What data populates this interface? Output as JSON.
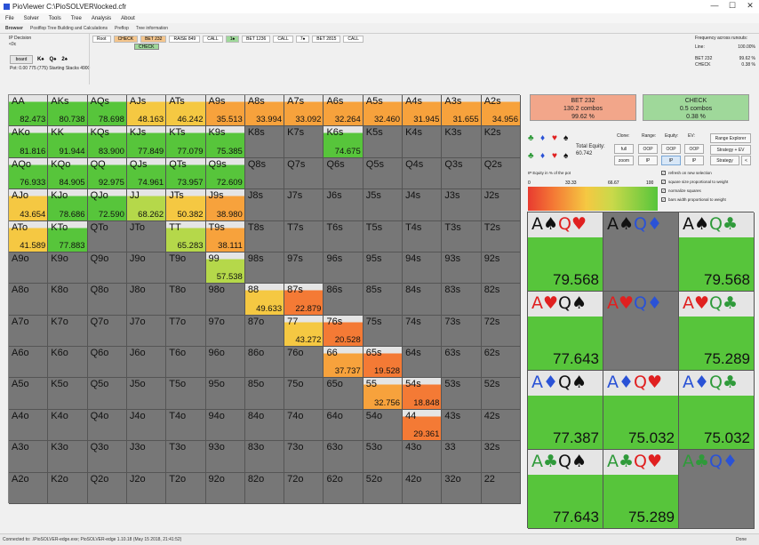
{
  "window": {
    "title": "PioViewer C:\\PioSOLVER\\locked.cfr",
    "minimize": "—",
    "maximize": "☐",
    "close": "✕"
  },
  "menu": [
    "File",
    "Solver",
    "Tools",
    "Tree",
    "Analysis",
    "About"
  ],
  "tabs": [
    "Browser",
    "Postflop Tree Building and Calculations",
    "Preflop",
    "Tree information"
  ],
  "left_info": {
    "decision": "IP Decision",
    "line": "<0c",
    "board_button": "board",
    "board_cards": [
      "K♠",
      "Q♠",
      "2♠"
    ],
    "pot": "Pot: 0.00 775 (775) Starting Stacks 4900"
  },
  "tree_nodes": [
    "Root",
    "CHECK",
    "BET 232",
    "RAISE 849",
    "CALL",
    "1♠",
    "BET 1236",
    "CALL",
    "7♠",
    "BET 2815",
    "CALL"
  ],
  "sub_check": "CHECK",
  "frequency": {
    "title": "Frequency across runouts:",
    "line_label": "Line:",
    "line_value": "100.00%",
    "rows": [
      {
        "label": "BET 232",
        "value": "99.62 %"
      },
      {
        "label": "CHECK",
        "value": "0.38 %"
      }
    ]
  },
  "actions": [
    {
      "name": "BET 232",
      "combos": "130.2 combos",
      "pct": "99.62 %",
      "color": "#f2a68a"
    },
    {
      "name": "CHECK",
      "combos": "0.5 combos",
      "pct": "0.38 %",
      "color": "#9fd89a"
    }
  ],
  "controls": {
    "total_equity_label": "Total Equity:",
    "total_equity_value": "60.742",
    "col_labels": [
      "Clone:",
      "Range:",
      "Equity:",
      "EV:"
    ],
    "buttons_row1": [
      "full",
      "OOP",
      "OOP",
      "OOP"
    ],
    "buttons_row2": [
      "zoom",
      "IP",
      "IP",
      "IP"
    ],
    "range_explorer": "Range Explorer",
    "strategy_ev": "Strategy + EV",
    "strategy": "Strategy",
    "back": "<",
    "ip_equity_note": "IP Equity in % of the pot",
    "checkboxes": [
      "refresh on new selection",
      "square size proportional to weight",
      "normalize squares",
      "bars width proportional to weight"
    ],
    "suits": [
      "♣",
      "♦",
      "♥",
      "♠",
      "♣",
      "♦",
      "♥",
      "♠"
    ]
  },
  "gradient_ticks": [
    "0",
    "33.33",
    "66.67",
    "100"
  ],
  "colors": {
    "empty": "#777777",
    "high": "#57c53b",
    "mid": "#f5c842",
    "low": "#f47a35",
    "red_suit": "#e02020",
    "blue_suit": "#2a52d6",
    "green_suit": "#2f9a3a",
    "black_suit": "#111111"
  },
  "hand_grid": [
    [
      {
        "n": "AA",
        "v": "82.473"
      },
      {
        "n": "AKs",
        "v": "80.738"
      },
      {
        "n": "AQs",
        "v": "78.698"
      },
      {
        "n": "AJs",
        "v": "48.163"
      },
      {
        "n": "ATs",
        "v": "46.242"
      },
      {
        "n": "A9s",
        "v": "35.513"
      },
      {
        "n": "A8s",
        "v": "33.994"
      },
      {
        "n": "A7s",
        "v": "33.092"
      },
      {
        "n": "A6s",
        "v": "32.264"
      },
      {
        "n": "A5s",
        "v": "32.460"
      },
      {
        "n": "A4s",
        "v": "31.945"
      },
      {
        "n": "A3s",
        "v": "31.655"
      },
      {
        "n": "A2s",
        "v": "34.956"
      }
    ],
    [
      {
        "n": "AKo",
        "v": "81.816"
      },
      {
        "n": "KK",
        "v": "91.944"
      },
      {
        "n": "KQs",
        "v": "83.900"
      },
      {
        "n": "KJs",
        "v": "77.849"
      },
      {
        "n": "KTs",
        "v": "77.079"
      },
      {
        "n": "K9s",
        "v": "75.385"
      },
      {
        "n": "K8s",
        "v": ""
      },
      {
        "n": "K7s",
        "v": ""
      },
      {
        "n": "K6s",
        "v": "74.675"
      },
      {
        "n": "K5s",
        "v": ""
      },
      {
        "n": "K4s",
        "v": ""
      },
      {
        "n": "K3s",
        "v": ""
      },
      {
        "n": "K2s",
        "v": ""
      }
    ],
    [
      {
        "n": "AQo",
        "v": "76.933"
      },
      {
        "n": "KQo",
        "v": "84.905"
      },
      {
        "n": "QQ",
        "v": "92.975"
      },
      {
        "n": "QJs",
        "v": "74.961"
      },
      {
        "n": "QTs",
        "v": "73.957"
      },
      {
        "n": "Q9s",
        "v": "72.609"
      },
      {
        "n": "Q8s",
        "v": ""
      },
      {
        "n": "Q7s",
        "v": ""
      },
      {
        "n": "Q6s",
        "v": ""
      },
      {
        "n": "Q5s",
        "v": ""
      },
      {
        "n": "Q4s",
        "v": ""
      },
      {
        "n": "Q3s",
        "v": ""
      },
      {
        "n": "Q2s",
        "v": ""
      }
    ],
    [
      {
        "n": "AJo",
        "v": "43.654"
      },
      {
        "n": "KJo",
        "v": "78.686"
      },
      {
        "n": "QJo",
        "v": "72.590"
      },
      {
        "n": "JJ",
        "v": "68.262"
      },
      {
        "n": "JTs",
        "v": "50.382"
      },
      {
        "n": "J9s",
        "v": "38.980"
      },
      {
        "n": "J8s",
        "v": ""
      },
      {
        "n": "J7s",
        "v": ""
      },
      {
        "n": "J6s",
        "v": ""
      },
      {
        "n": "J5s",
        "v": ""
      },
      {
        "n": "J4s",
        "v": ""
      },
      {
        "n": "J3s",
        "v": ""
      },
      {
        "n": "J2s",
        "v": ""
      }
    ],
    [
      {
        "n": "ATo",
        "v": "41.589"
      },
      {
        "n": "KTo",
        "v": "77.883"
      },
      {
        "n": "QTo",
        "v": ""
      },
      {
        "n": "JTo",
        "v": ""
      },
      {
        "n": "TT",
        "v": "65.283"
      },
      {
        "n": "T9s",
        "v": "38.111"
      },
      {
        "n": "T8s",
        "v": ""
      },
      {
        "n": "T7s",
        "v": ""
      },
      {
        "n": "T6s",
        "v": ""
      },
      {
        "n": "T5s",
        "v": ""
      },
      {
        "n": "T4s",
        "v": ""
      },
      {
        "n": "T3s",
        "v": ""
      },
      {
        "n": "T2s",
        "v": ""
      }
    ],
    [
      {
        "n": "A9o",
        "v": ""
      },
      {
        "n": "K9o",
        "v": ""
      },
      {
        "n": "Q9o",
        "v": ""
      },
      {
        "n": "J9o",
        "v": ""
      },
      {
        "n": "T9o",
        "v": ""
      },
      {
        "n": "99",
        "v": "57.538"
      },
      {
        "n": "98s",
        "v": ""
      },
      {
        "n": "97s",
        "v": ""
      },
      {
        "n": "96s",
        "v": ""
      },
      {
        "n": "95s",
        "v": ""
      },
      {
        "n": "94s",
        "v": ""
      },
      {
        "n": "93s",
        "v": ""
      },
      {
        "n": "92s",
        "v": ""
      }
    ],
    [
      {
        "n": "A8o",
        "v": ""
      },
      {
        "n": "K8o",
        "v": ""
      },
      {
        "n": "Q8o",
        "v": ""
      },
      {
        "n": "J8o",
        "v": ""
      },
      {
        "n": "T8o",
        "v": ""
      },
      {
        "n": "98o",
        "v": ""
      },
      {
        "n": "88",
        "v": "49.633"
      },
      {
        "n": "87s",
        "v": "22.879"
      },
      {
        "n": "86s",
        "v": ""
      },
      {
        "n": "85s",
        "v": ""
      },
      {
        "n": "84s",
        "v": ""
      },
      {
        "n": "83s",
        "v": ""
      },
      {
        "n": "82s",
        "v": ""
      }
    ],
    [
      {
        "n": "A7o",
        "v": ""
      },
      {
        "n": "K7o",
        "v": ""
      },
      {
        "n": "Q7o",
        "v": ""
      },
      {
        "n": "J7o",
        "v": ""
      },
      {
        "n": "T7o",
        "v": ""
      },
      {
        "n": "97o",
        "v": ""
      },
      {
        "n": "87o",
        "v": ""
      },
      {
        "n": "77",
        "v": "43.272"
      },
      {
        "n": "76s",
        "v": "20.528"
      },
      {
        "n": "75s",
        "v": ""
      },
      {
        "n": "74s",
        "v": ""
      },
      {
        "n": "73s",
        "v": ""
      },
      {
        "n": "72s",
        "v": ""
      }
    ],
    [
      {
        "n": "A6o",
        "v": ""
      },
      {
        "n": "K6o",
        "v": ""
      },
      {
        "n": "Q6o",
        "v": ""
      },
      {
        "n": "J6o",
        "v": ""
      },
      {
        "n": "T6o",
        "v": ""
      },
      {
        "n": "96o",
        "v": ""
      },
      {
        "n": "86o",
        "v": ""
      },
      {
        "n": "76o",
        "v": ""
      },
      {
        "n": "66",
        "v": "37.737"
      },
      {
        "n": "65s",
        "v": "19.528"
      },
      {
        "n": "64s",
        "v": ""
      },
      {
        "n": "63s",
        "v": ""
      },
      {
        "n": "62s",
        "v": ""
      }
    ],
    [
      {
        "n": "A5o",
        "v": ""
      },
      {
        "n": "K5o",
        "v": ""
      },
      {
        "n": "Q5o",
        "v": ""
      },
      {
        "n": "J5o",
        "v": ""
      },
      {
        "n": "T5o",
        "v": ""
      },
      {
        "n": "95o",
        "v": ""
      },
      {
        "n": "85o",
        "v": ""
      },
      {
        "n": "75o",
        "v": ""
      },
      {
        "n": "65o",
        "v": ""
      },
      {
        "n": "55",
        "v": "32.756"
      },
      {
        "n": "54s",
        "v": "18.848"
      },
      {
        "n": "53s",
        "v": ""
      },
      {
        "n": "52s",
        "v": ""
      }
    ],
    [
      {
        "n": "A4o",
        "v": ""
      },
      {
        "n": "K4o",
        "v": ""
      },
      {
        "n": "Q4o",
        "v": ""
      },
      {
        "n": "J4o",
        "v": ""
      },
      {
        "n": "T4o",
        "v": ""
      },
      {
        "n": "94o",
        "v": ""
      },
      {
        "n": "84o",
        "v": ""
      },
      {
        "n": "74o",
        "v": ""
      },
      {
        "n": "64o",
        "v": ""
      },
      {
        "n": "54o",
        "v": ""
      },
      {
        "n": "44",
        "v": "29.361"
      },
      {
        "n": "43s",
        "v": ""
      },
      {
        "n": "42s",
        "v": ""
      }
    ],
    [
      {
        "n": "A3o",
        "v": ""
      },
      {
        "n": "K3o",
        "v": ""
      },
      {
        "n": "Q3o",
        "v": ""
      },
      {
        "n": "J3o",
        "v": ""
      },
      {
        "n": "T3o",
        "v": ""
      },
      {
        "n": "93o",
        "v": ""
      },
      {
        "n": "83o",
        "v": ""
      },
      {
        "n": "73o",
        "v": ""
      },
      {
        "n": "63o",
        "v": ""
      },
      {
        "n": "53o",
        "v": ""
      },
      {
        "n": "43o",
        "v": ""
      },
      {
        "n": "33",
        "v": ""
      },
      {
        "n": "32s",
        "v": ""
      }
    ],
    [
      {
        "n": "A2o",
        "v": ""
      },
      {
        "n": "K2o",
        "v": ""
      },
      {
        "n": "Q2o",
        "v": ""
      },
      {
        "n": "J2o",
        "v": ""
      },
      {
        "n": "T2o",
        "v": ""
      },
      {
        "n": "92o",
        "v": ""
      },
      {
        "n": "82o",
        "v": ""
      },
      {
        "n": "72o",
        "v": ""
      },
      {
        "n": "62o",
        "v": ""
      },
      {
        "n": "52o",
        "v": ""
      },
      {
        "n": "42o",
        "v": ""
      },
      {
        "n": "32o",
        "v": ""
      },
      {
        "n": "22",
        "v": ""
      }
    ]
  ],
  "combo_grid": [
    [
      {
        "c": [
          [
            "A",
            "s"
          ],
          [
            "Q",
            "h"
          ]
        ],
        "v": "79.568"
      },
      {
        "c": [
          [
            "A",
            "s"
          ],
          [
            "Q",
            "d"
          ]
        ],
        "v": ""
      },
      {
        "c": [
          [
            "A",
            "s"
          ],
          [
            "Q",
            "c"
          ]
        ],
        "v": "79.568"
      }
    ],
    [
      {
        "c": [
          [
            "A",
            "h"
          ],
          [
            "Q",
            "s"
          ]
        ],
        "v": "77.643"
      },
      {
        "c": [
          [
            "A",
            "h"
          ],
          [
            "Q",
            "d"
          ]
        ],
        "v": ""
      },
      {
        "c": [
          [
            "A",
            "h"
          ],
          [
            "Q",
            "c"
          ]
        ],
        "v": "75.289"
      }
    ],
    [
      {
        "c": [
          [
            "A",
            "d"
          ],
          [
            "Q",
            "s"
          ]
        ],
        "v": "77.387"
      },
      {
        "c": [
          [
            "A",
            "d"
          ],
          [
            "Q",
            "h"
          ]
        ],
        "v": "75.032"
      },
      {
        "c": [
          [
            "A",
            "d"
          ],
          [
            "Q",
            "c"
          ]
        ],
        "v": "75.032"
      }
    ],
    [
      {
        "c": [
          [
            "A",
            "c"
          ],
          [
            "Q",
            "s"
          ]
        ],
        "v": "77.643"
      },
      {
        "c": [
          [
            "A",
            "c"
          ],
          [
            "Q",
            "h"
          ]
        ],
        "v": "75.289"
      },
      {
        "c": [
          [
            "A",
            "c"
          ],
          [
            "Q",
            "d"
          ]
        ],
        "v": ""
      }
    ]
  ],
  "status": {
    "text": "Connected to: .\\PioSOLVER-edge.exe; PioSOLVER-edge 1.10.18 (May 15 2018, 21:41:52)",
    "right": "Done"
  }
}
